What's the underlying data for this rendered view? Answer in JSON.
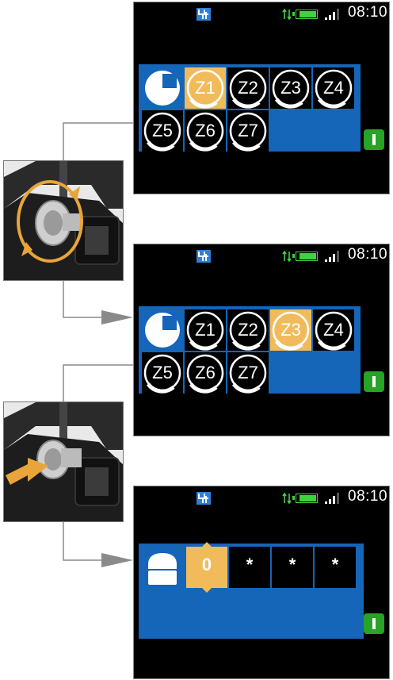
{
  "status": {
    "time": "08:10"
  },
  "screen1": {
    "zones": [
      {
        "label": "Z1",
        "selected": true
      },
      {
        "label": "Z2",
        "selected": false
      },
      {
        "label": "Z3",
        "selected": false
      },
      {
        "label": "Z4",
        "selected": false
      },
      {
        "label": "Z5",
        "selected": false
      },
      {
        "label": "Z6",
        "selected": false
      },
      {
        "label": "Z7",
        "selected": false
      }
    ]
  },
  "screen2": {
    "zones": [
      {
        "label": "Z1",
        "selected": false
      },
      {
        "label": "Z2",
        "selected": false
      },
      {
        "label": "Z3",
        "selected": true
      },
      {
        "label": "Z4",
        "selected": false
      },
      {
        "label": "Z5",
        "selected": false
      },
      {
        "label": "Z6",
        "selected": false
      },
      {
        "label": "Z7",
        "selected": false
      }
    ]
  },
  "screen3": {
    "pin_digits": [
      "0",
      "*",
      "*",
      "*"
    ]
  },
  "colors": {
    "panel": "#1565b9",
    "selected": "#f1bb5b",
    "ok": "#27a327",
    "battery": "#3fd23f"
  },
  "icons": [
    "partial-lock-icon",
    "padlock-icon",
    "ok-button-icon",
    "turn-knob-arrows-icon",
    "push-arrow-icon"
  ]
}
